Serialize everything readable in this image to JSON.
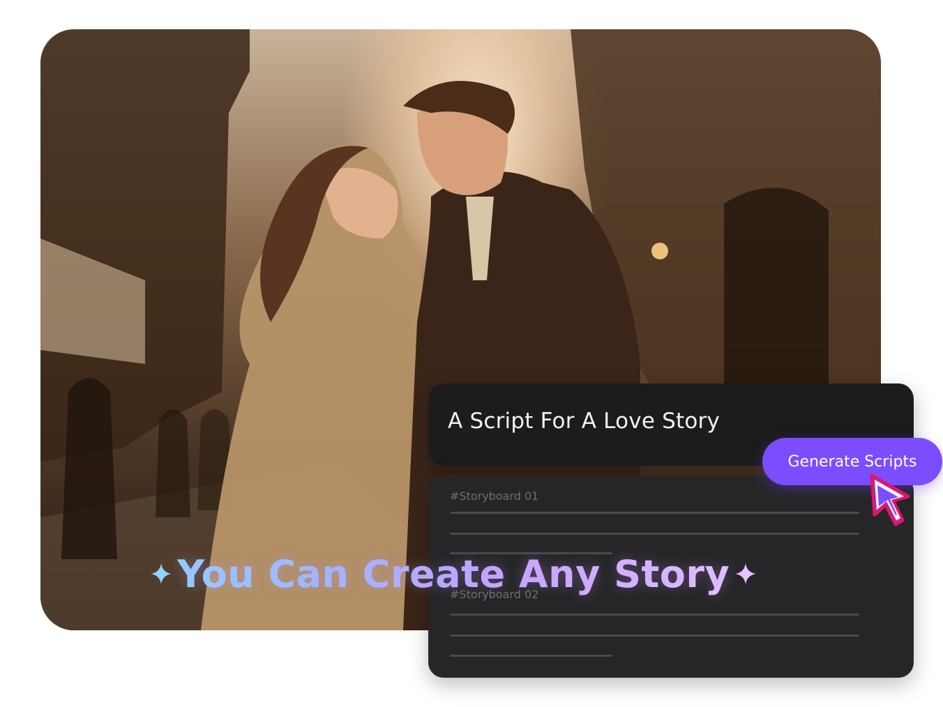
{
  "prompt": {
    "text": "A Script For A Love Story"
  },
  "generate_button": {
    "label": "Generate Scripts"
  },
  "storyboards": [
    {
      "label": "#Storyboard 01"
    },
    {
      "label": "#Storyboard 02"
    }
  ],
  "headline": {
    "text": "You Can Create Any Story"
  },
  "colors": {
    "button": "#7c4dff",
    "card_dark": "#1c1c1e",
    "card_board": "#262628",
    "cursor_fill": "#7c4dff",
    "cursor_outline": "#e0156a",
    "headline_start": "#8fd3ff",
    "headline_end": "#e8c3ff"
  },
  "icons": {
    "cursor": "mouse-pointer-icon",
    "sparkle": "sparkle-icon"
  }
}
